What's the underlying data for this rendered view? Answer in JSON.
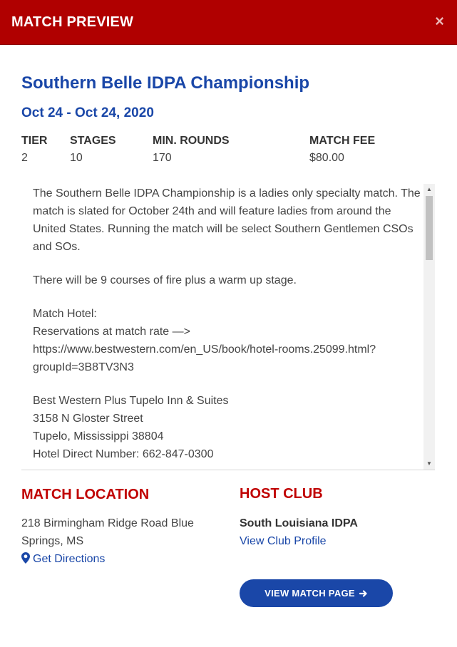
{
  "header": {
    "title": "MATCH PREVIEW",
    "close_icon": "close-icon",
    "close_glyph": "×",
    "bg_color": "#b00000"
  },
  "match": {
    "title": "Southern Belle IDPA Championship",
    "date": "Oct 24 - Oct 24, 2020",
    "title_color": "#1a47a8"
  },
  "stats": {
    "tier_label": "TIER",
    "tier_value": "2",
    "stages_label": "STAGES",
    "stages_value": "10",
    "min_rounds_label": "MIN. ROUNDS",
    "min_rounds_value": "170",
    "match_fee_label": "MATCH FEE",
    "match_fee_value": "$80.00"
  },
  "description": {
    "paragraph1": "The Southern Belle IDPA Championship is a ladies only specialty match. The match is slated for October 24th and will feature ladies from around the United States. Running the match will be select Southern Gentlemen CSOs and SOs.",
    "paragraph2": "There will be 9 courses of fire plus a warm up stage.",
    "hotel_label": "Match Hotel:",
    "hotel_reservations": "Reservations at match rate —>",
    "hotel_url_line1": "https://www.bestwestern.com/en_US/book/hotel-rooms.25099.html?",
    "hotel_url_line2": "groupId=3B8TV3N3",
    "hotel_name": "Best Western Plus Tupelo Inn & Suites",
    "hotel_street": "3158 N Gloster Street",
    "hotel_city": "Tupelo, Mississippi 38804",
    "hotel_phone": "Hotel Direct Number: 662-847-0300"
  },
  "location": {
    "heading": "MATCH LOCATION",
    "address": "218 Birmingham Ridge Road Blue Springs, MS",
    "directions_label": "Get Directions",
    "directions_icon": "map-marker-icon"
  },
  "host_club": {
    "heading": "HOST CLUB",
    "name": "South Louisiana IDPA",
    "profile_link": "View Club Profile"
  },
  "actions": {
    "view_match_page": "VIEW MATCH PAGE",
    "arrow_icon": "arrow-right-icon",
    "accent_color": "#1a47a8",
    "heading_color": "#c00000"
  }
}
